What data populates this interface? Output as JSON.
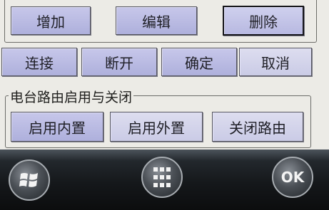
{
  "top_buttons": {
    "add": "增加",
    "edit": "编辑",
    "delete": "删除"
  },
  "connection_buttons": {
    "connect": "连接",
    "disconnect": "断开",
    "confirm": "确定",
    "cancel": "取消"
  },
  "router_group": {
    "title": "电台路由启用与关闭",
    "enable_internal": "启用内置",
    "enable_external": "启用外置",
    "close_router": "关闭路由"
  },
  "taskbar": {
    "ok_label": "OK",
    "icons": [
      "windows-start-icon",
      "apps-grid-icon",
      "ok-icon"
    ]
  }
}
